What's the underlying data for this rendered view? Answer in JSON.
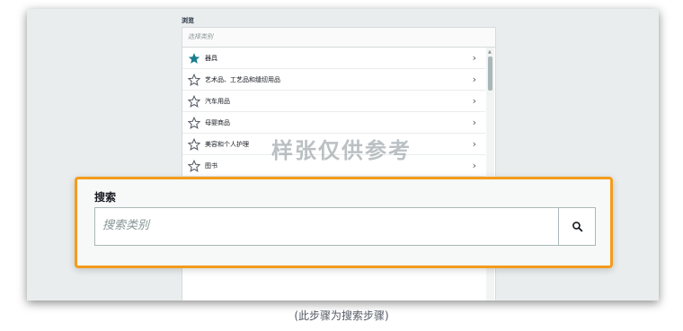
{
  "browse": {
    "label": "浏览",
    "select_placeholder": "选择类别",
    "categories": [
      {
        "label": "器具",
        "icon": "star-filled-icon",
        "selected": true
      },
      {
        "label": "艺术品、工艺品和缝纫用品",
        "icon": "star-outline-icon",
        "selected": false
      },
      {
        "label": "汽车用品",
        "icon": "star-outline-icon",
        "selected": false
      },
      {
        "label": "母婴商品",
        "icon": "star-outline-icon",
        "selected": false
      },
      {
        "label": "美容和个人护理",
        "icon": "star-outline-icon",
        "selected": false
      },
      {
        "label": "图书",
        "icon": "star-outline-icon",
        "selected": false
      }
    ],
    "chevron": "›"
  },
  "watermark": "样张仅供参考",
  "search": {
    "title": "搜索",
    "placeholder": "搜索类别",
    "value": "",
    "button_icon": "search-icon"
  },
  "caption": "(此步骤为搜索步骤)",
  "colors": {
    "highlight_border": "#f39c1c",
    "star_filled": "#1a7f8e",
    "star_outline": "#545b64",
    "background": "#eaeded"
  }
}
